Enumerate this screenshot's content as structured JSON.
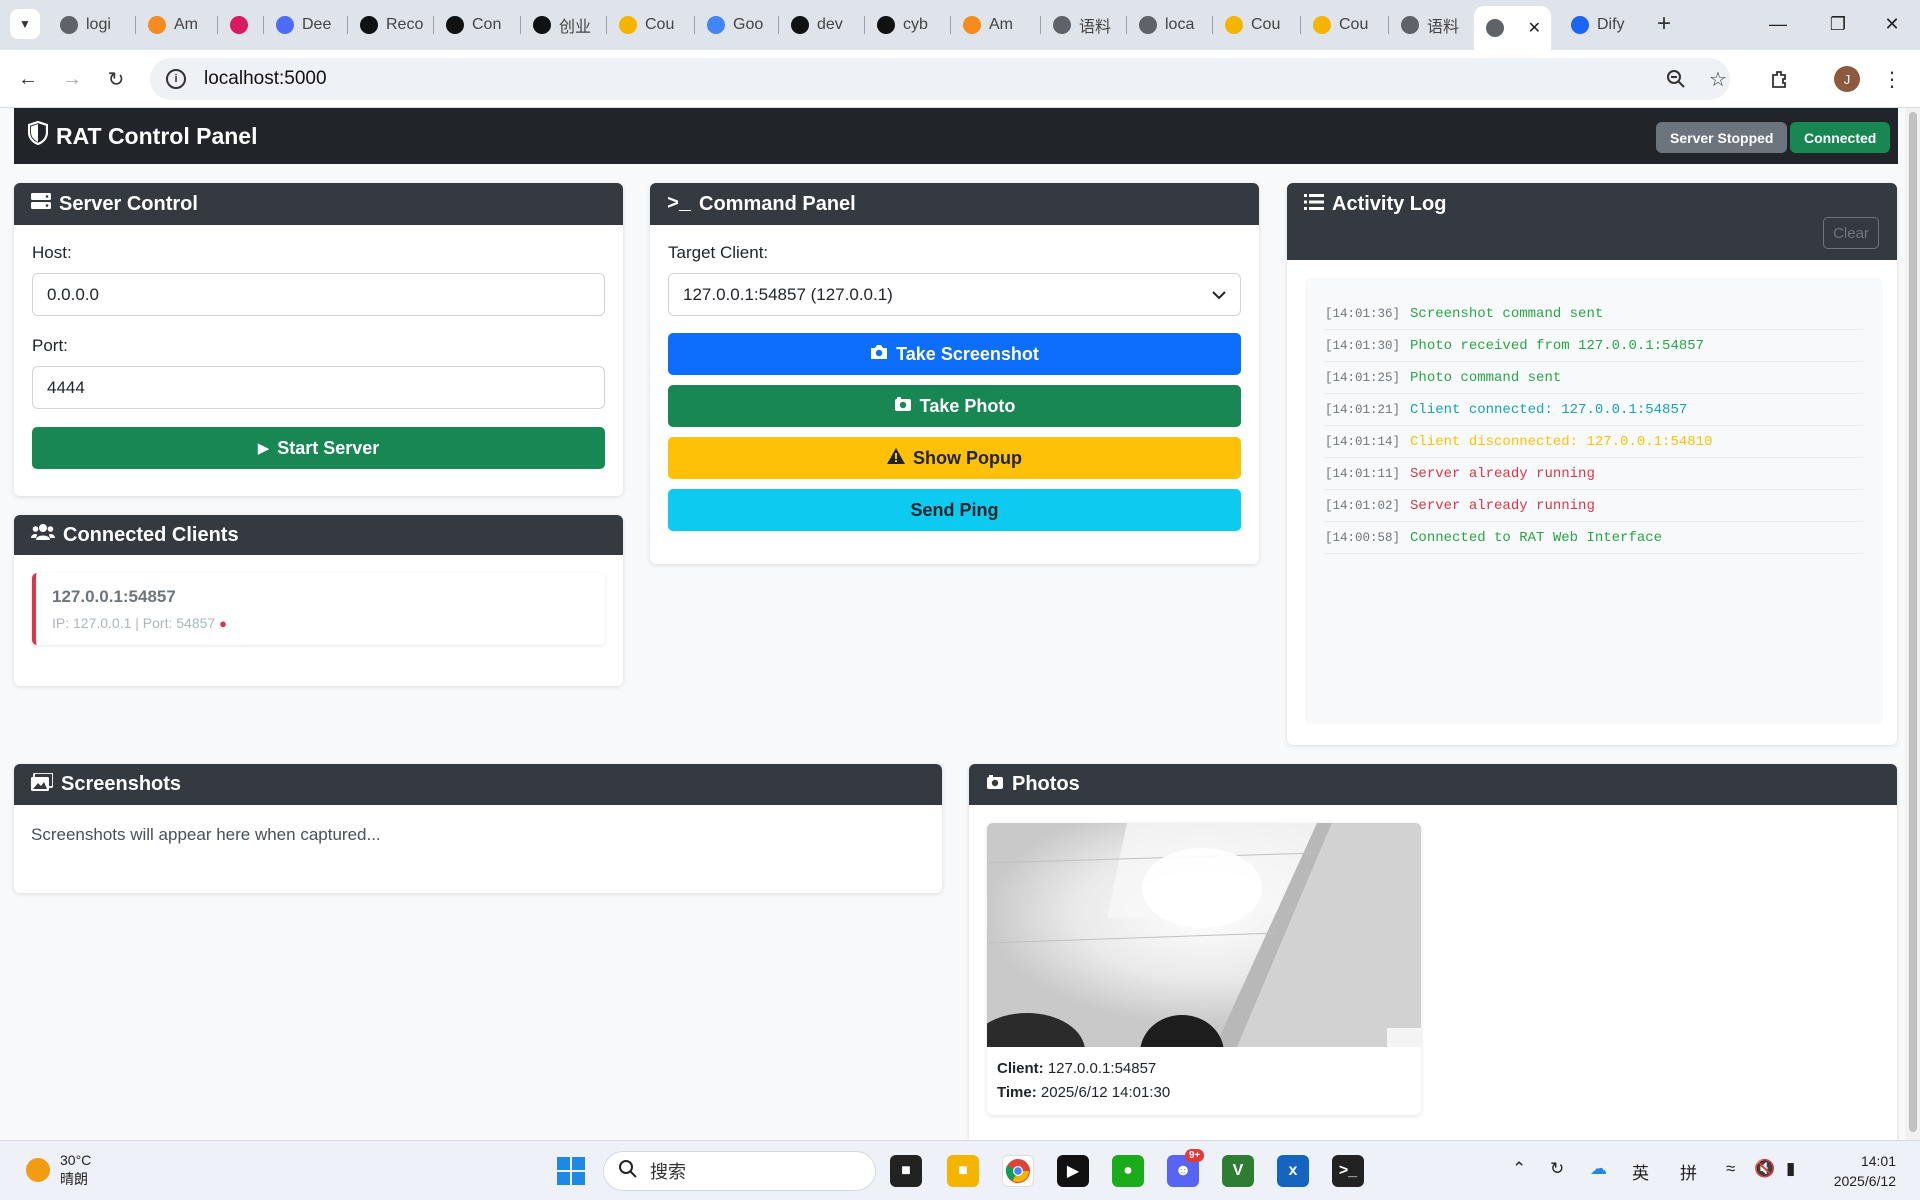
{
  "browser": {
    "tabs": [
      {
        "label": "logi",
        "icon": "globe-icon",
        "color": "#5f6368"
      },
      {
        "label": "Am",
        "icon": "aws-cube-icon",
        "color": "#f68b1f"
      },
      {
        "label": "",
        "icon": "pink-app-icon",
        "color": "#d81b60"
      },
      {
        "label": "Dee",
        "icon": "deepseek-icon",
        "color": "#4d6bfe"
      },
      {
        "label": "Reco",
        "icon": "openai-icon",
        "color": "#111111"
      },
      {
        "label": "Con",
        "icon": "openai-icon",
        "color": "#111111"
      },
      {
        "label": "创业",
        "icon": "openai-icon",
        "color": "#111111"
      },
      {
        "label": "Cou",
        "icon": "slides-icon",
        "color": "#f4b400"
      },
      {
        "label": "Goo",
        "icon": "translate-icon",
        "color": "#4285f4"
      },
      {
        "label": "dev",
        "icon": "github-icon",
        "color": "#111111"
      },
      {
        "label": "cyb",
        "icon": "github-icon",
        "color": "#111111"
      },
      {
        "label": "Am",
        "icon": "aws-cube-icon",
        "color": "#f68b1f"
      },
      {
        "label": "语料",
        "icon": "globe-icon",
        "color": "#5f6368"
      },
      {
        "label": "loca",
        "icon": "globe-icon",
        "color": "#5f6368"
      },
      {
        "label": "Cou",
        "icon": "slides-icon",
        "color": "#f4b400"
      },
      {
        "label": "Cou",
        "icon": "slides-icon",
        "color": "#f4b400"
      },
      {
        "label": "语料",
        "icon": "globe-icon",
        "color": "#5f6368"
      },
      {
        "label": "",
        "icon": "globe-icon",
        "color": "#5f6368",
        "active": true
      },
      {
        "label": "Dify",
        "icon": "dify-icon",
        "color": "#1c64f2"
      }
    ],
    "url": "localhost:5000"
  },
  "app": {
    "title": "RAT Control Panel",
    "status_server": "Server Stopped",
    "status_connection": "Connected"
  },
  "server_control": {
    "title": "Server Control",
    "host_label": "Host:",
    "host_value": "0.0.0.0",
    "port_label": "Port:",
    "port_value": "4444",
    "start_button": "Start Server"
  },
  "clients": {
    "title": "Connected Clients",
    "items": [
      {
        "name": "127.0.0.1:54857",
        "meta": "IP: 127.0.0.1 | Port: 54857"
      }
    ]
  },
  "command_panel": {
    "title": "Command Panel",
    "target_label": "Target Client:",
    "target_value": "127.0.0.1:54857 (127.0.0.1)",
    "screenshot_button": "Take Screenshot",
    "photo_button": "Take Photo",
    "popup_button": "Show Popup",
    "ping_button": "Send Ping"
  },
  "activity_log": {
    "title": "Activity Log",
    "clear_button": "Clear",
    "entries": [
      {
        "time": "[14:01:36]",
        "message": "Screenshot command sent",
        "level": "success"
      },
      {
        "time": "[14:01:30]",
        "message": "Photo received from 127.0.0.1:54857",
        "level": "success"
      },
      {
        "time": "[14:01:25]",
        "message": "Photo command sent",
        "level": "success"
      },
      {
        "time": "[14:01:21]",
        "message": "Client connected: 127.0.0.1:54857",
        "level": "info"
      },
      {
        "time": "[14:01:14]",
        "message": "Client disconnected: 127.0.0.1:54810",
        "level": "warning"
      },
      {
        "time": "[14:01:11]",
        "message": "Server already running",
        "level": "error"
      },
      {
        "time": "[14:01:02]",
        "message": "Server already running",
        "level": "error"
      },
      {
        "time": "[14:00:58]",
        "message": "Connected to RAT Web Interface",
        "level": "success"
      }
    ]
  },
  "screenshots": {
    "title": "Screenshots",
    "empty_text": "Screenshots will appear here when captured..."
  },
  "photos": {
    "title": "Photos",
    "items": [
      {
        "client_label": "Client:",
        "client_value": "127.0.0.1:54857",
        "time_label": "Time:",
        "time_value": "2025/6/12 14:01:30"
      }
    ]
  },
  "taskbar": {
    "weather_temp": "30°C",
    "weather_desc": "晴朗",
    "search_placeholder": "搜索",
    "ime_lang": "英",
    "ime_mode": "拼",
    "clock_time": "14:01",
    "clock_date": "2025/6/12",
    "discord_badge": "9+"
  },
  "colors": {
    "success": "#28a745",
    "info": "#17a2b8",
    "warning": "#ffc107",
    "error": "#dc3545",
    "primary": "#0d6efd",
    "dark_green": "#198754",
    "cyan": "#0dcaf0",
    "gray_badge": "#6c757d"
  }
}
